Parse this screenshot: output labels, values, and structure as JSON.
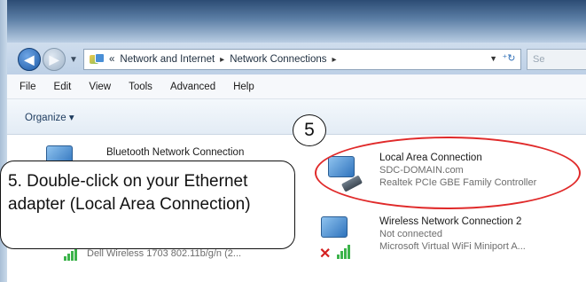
{
  "address_bar": {
    "crumb_prefix": "«",
    "crumbs": [
      "Network and Internet",
      "Network Connections"
    ],
    "separator": "▸",
    "search_placeholder": "Se"
  },
  "menu": [
    "File",
    "Edit",
    "View",
    "Tools",
    "Advanced",
    "Help"
  ],
  "toolbar": {
    "organize": "Organize ▾"
  },
  "connections": {
    "bluetooth": {
      "name": "Bluetooth Network Connection"
    },
    "wifi_adapter": {
      "sub": "Dell Wireless 1703 802.11b/g/n (2..."
    },
    "local_area": {
      "name": "Local Area Connection",
      "status": "SDC-DOMAIN.com",
      "adapter": "Realtek PCIe GBE Family Controller"
    },
    "wireless2": {
      "name": "Wireless Network Connection 2",
      "status": "Not connected",
      "adapter": "Microsoft Virtual WiFi Miniport A..."
    }
  },
  "annotation": {
    "step_number": "5",
    "callout_text": "5.  Double-click on your Ethernet adapter (Local Area Connection)"
  },
  "icons": {
    "back": "arrow-left-icon",
    "forward": "arrow-right-icon",
    "refresh": "refresh-icon",
    "network_adapter": "network-adapter-icon",
    "disconnected": "red-x-icon",
    "signal": "signal-bars-icon"
  },
  "colors": {
    "highlight": "#e02a2a",
    "title_gradient_top": "#2c4c74"
  }
}
